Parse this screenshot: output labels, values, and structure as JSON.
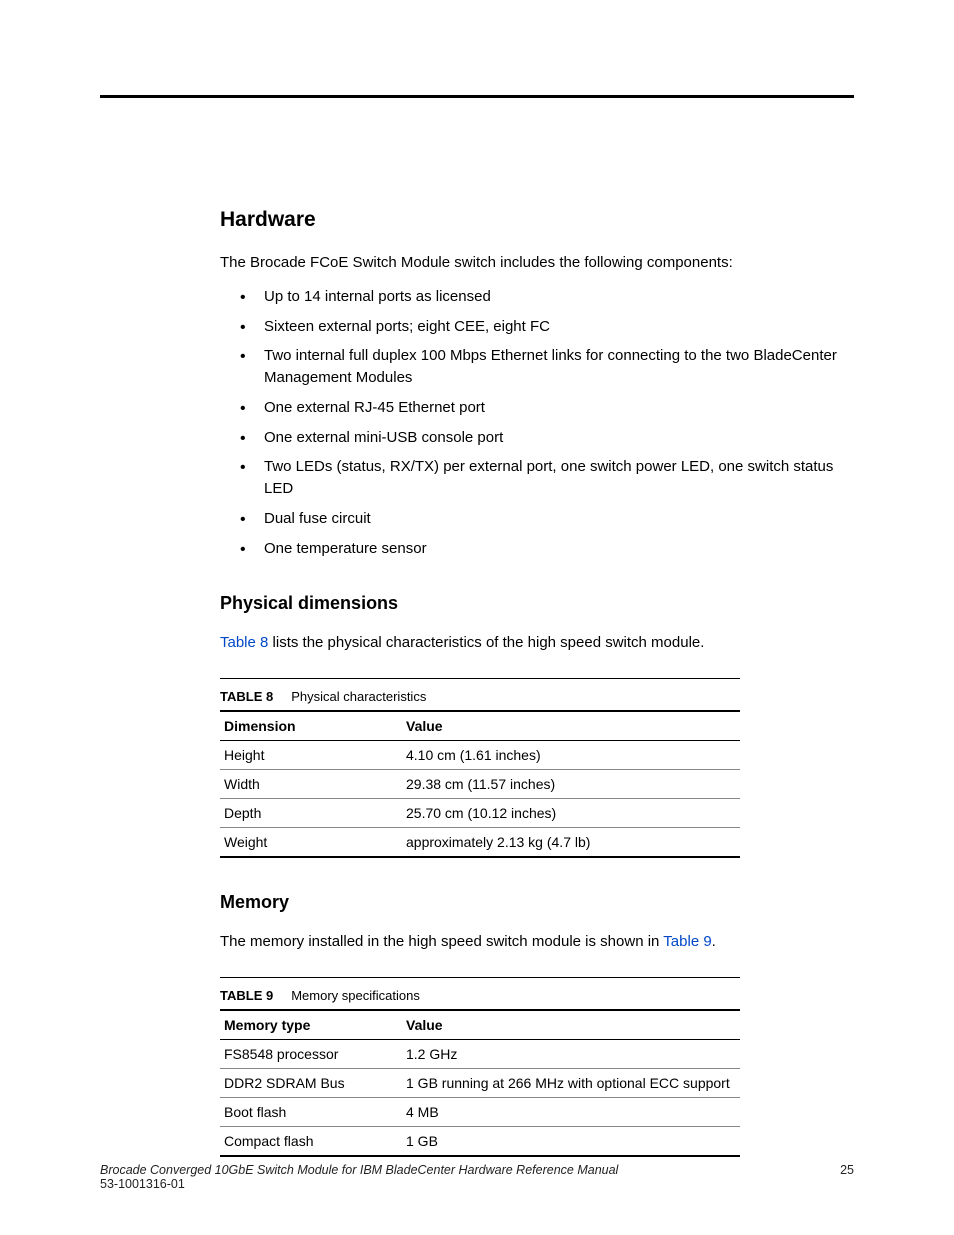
{
  "section_hw": {
    "title": "Hardware",
    "intro": "The Brocade FCoE Switch Module switch includes the following components:",
    "bullets": [
      "Up to 14 internal ports as licensed",
      "Sixteen external ports; eight CEE, eight FC",
      "Two internal full duplex 100 Mbps Ethernet links for connecting to the two BladeCenter Management Modules",
      "One external RJ-45 Ethernet port",
      "One external mini-USB console port",
      "Two LEDs (status, RX/TX) per external port, one switch power LED, one switch status LED",
      "Dual fuse circuit",
      "One temperature sensor"
    ]
  },
  "section_phys": {
    "title": "Physical dimensions",
    "body_pre": "Table 8",
    "body_post": " lists the physical characteristics of the high speed switch module.",
    "table": {
      "caption_label": "TABLE 8",
      "caption_text": "Physical characteristics",
      "headers": [
        "Dimension",
        "Value"
      ],
      "rows": [
        [
          "Height",
          "4.10 cm (1.61 inches)"
        ],
        [
          "Width",
          "29.38 cm (11.57 inches)"
        ],
        [
          "Depth",
          "25.70 cm (10.12 inches)"
        ],
        [
          "Weight",
          "approximately 2.13 kg (4.7 lb)"
        ]
      ]
    }
  },
  "section_mem": {
    "title": "Memory",
    "body_pre": "The memory installed in the high speed switch module is shown in ",
    "body_link": "Table 9",
    "body_post": ".",
    "table": {
      "caption_label": "TABLE 9",
      "caption_text": "Memory specifications",
      "headers": [
        "Memory type",
        "Value"
      ],
      "rows": [
        [
          "FS8548 processor",
          "1.2 GHz"
        ],
        [
          "DDR2 SDRAM Bus",
          "1 GB running at 266 MHz with optional ECC support"
        ],
        [
          "Boot flash",
          "4 MB"
        ],
        [
          "Compact flash",
          "1 GB"
        ]
      ]
    }
  },
  "footer": {
    "doc_title": "Brocade Converged 10GbE Switch Module for IBM BladeCenter Hardware Reference Manual",
    "doc_num": "53-1001316-01",
    "page": "25"
  }
}
